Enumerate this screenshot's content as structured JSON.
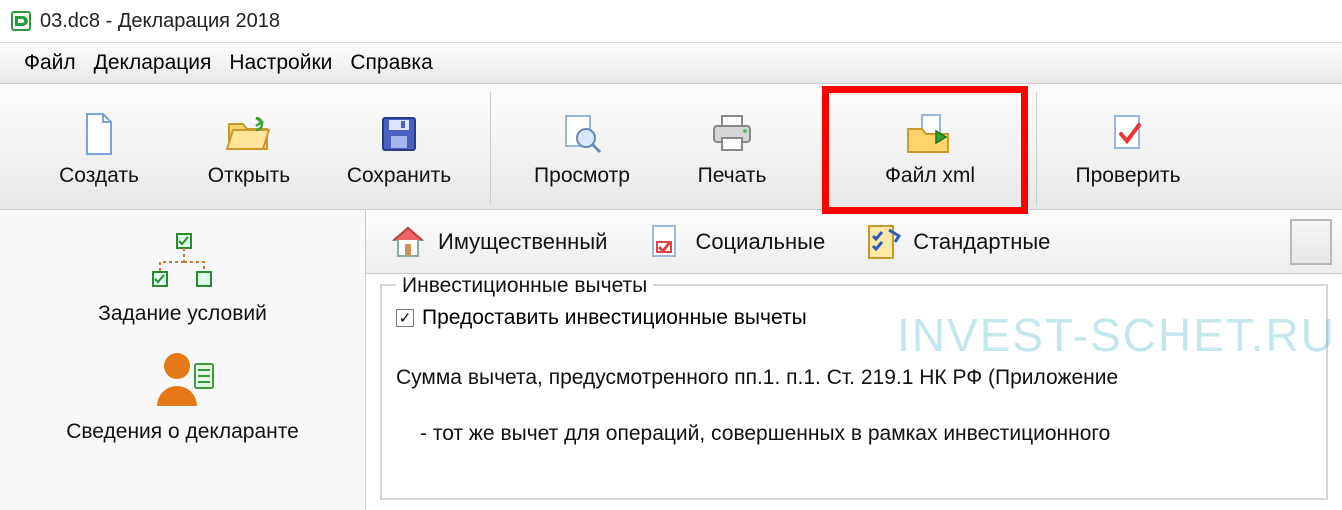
{
  "title": "03.dc8 - Декларация 2018",
  "menu": {
    "file": "Файл",
    "declaration": "Декларация",
    "settings": "Настройки",
    "help": "Справка"
  },
  "toolbar": {
    "create": "Создать",
    "open": "Открыть",
    "save": "Сохранить",
    "preview": "Просмотр",
    "print": "Печать",
    "xmlfile": "Файл xml",
    "check": "Проверить"
  },
  "sidebar": {
    "conditions": "Задание условий",
    "declarant": "Сведения о декларанте"
  },
  "tabs": {
    "property": "Имущественный",
    "social": "Социальные",
    "standard": "Стандартные"
  },
  "section": {
    "legend": "Инвестиционные вычеты",
    "checkbox_label": "Предоставить инвестиционные вычеты",
    "checkbox_checked": "✓",
    "line1": "Сумма вычета, предусмотренного пп.1. п.1. Ст. 219.1 НК РФ (Приложение",
    "line2": "- тот же вычет для операций, совершенных в рамках инвестиционного"
  },
  "watermark": "INVEST-SCHET.RU"
}
